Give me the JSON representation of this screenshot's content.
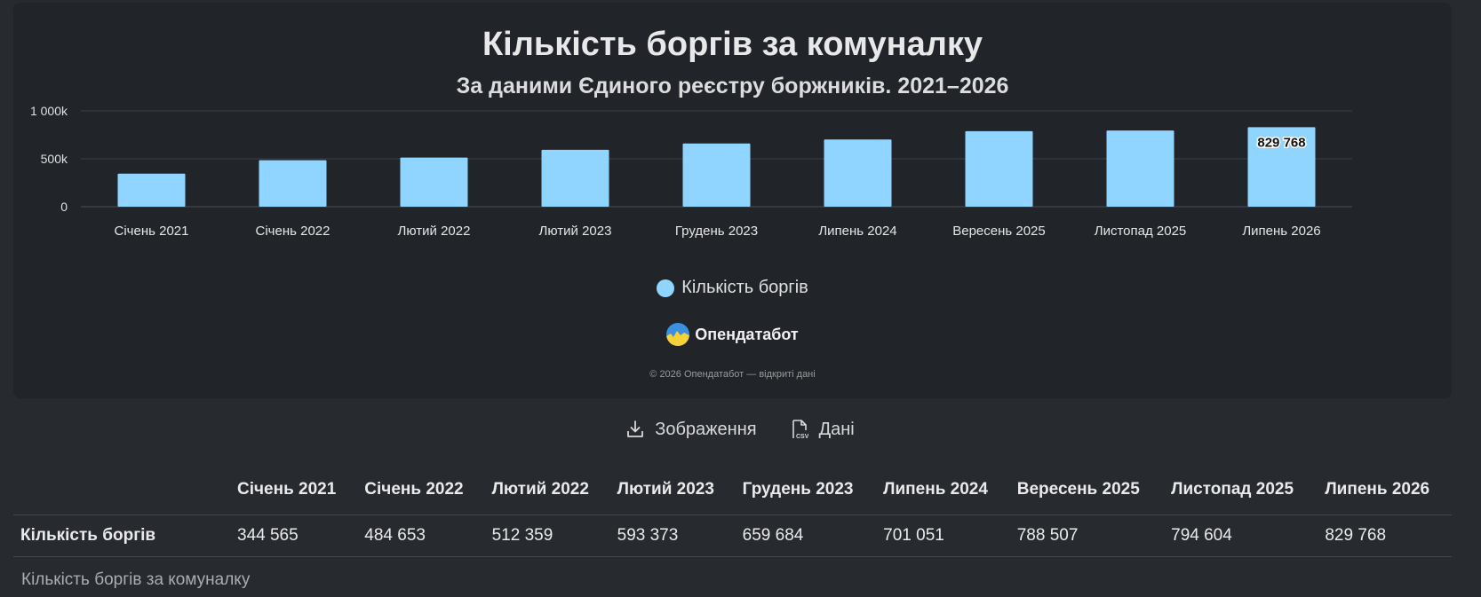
{
  "chart": {
    "title": "Кількість боргів за комуналку",
    "subtitle": "За даними Єдиного реєстру боржників. 2021–2026",
    "legend_label": "Кількість боргів",
    "brand": "Опендатабот",
    "copyright": "© 2026 Опендатабот — відкриті дані"
  },
  "chart_data": {
    "type": "bar",
    "title": "Кількість боргів за комуналку",
    "subtitle": "За даними Єдиного реєстру боржників. 2021–2026",
    "categories": [
      "Січень 2021",
      "Січень 2022",
      "Лютий 2022",
      "Лютий 2023",
      "Грудень 2023",
      "Липень 2024",
      "Вересень 2025",
      "Листопад 2025",
      "Липень 2026"
    ],
    "series": [
      {
        "name": "Кількість боргів",
        "values": [
          344565,
          484653,
          512359,
          593373,
          659684,
          701051,
          788507,
          794604,
          829768
        ]
      }
    ],
    "ylim": [
      0,
      1000000
    ],
    "yticks": [
      0,
      500000,
      1000000
    ],
    "ytick_labels": [
      "0",
      "500k",
      "1 000k"
    ],
    "data_labels": [
      {
        "category": "Липень 2026",
        "text": "829 768"
      }
    ],
    "color": "#90d5ff",
    "grid": true,
    "legend": "bottom"
  },
  "actions": {
    "image_label": "Зображення",
    "data_label": "Дані"
  },
  "table": {
    "columns": [
      "Січень 2021",
      "Січень 2022",
      "Лютий 2022",
      "Лютий 2023",
      "Грудень 2023",
      "Липень 2024",
      "Вересень 2025",
      "Листопад 2025",
      "Липень 2026"
    ],
    "row_label": "Кількість боргів",
    "values": [
      "344 565",
      "484 653",
      "512 359",
      "593 373",
      "659 684",
      "701 051",
      "788 507",
      "794 604",
      "829 768"
    ]
  },
  "caption": "Кількість боргів за комуналку",
  "colors": {
    "bar": "#90d5ff",
    "page_bg": "#272b30",
    "card_bg": "#212429"
  }
}
